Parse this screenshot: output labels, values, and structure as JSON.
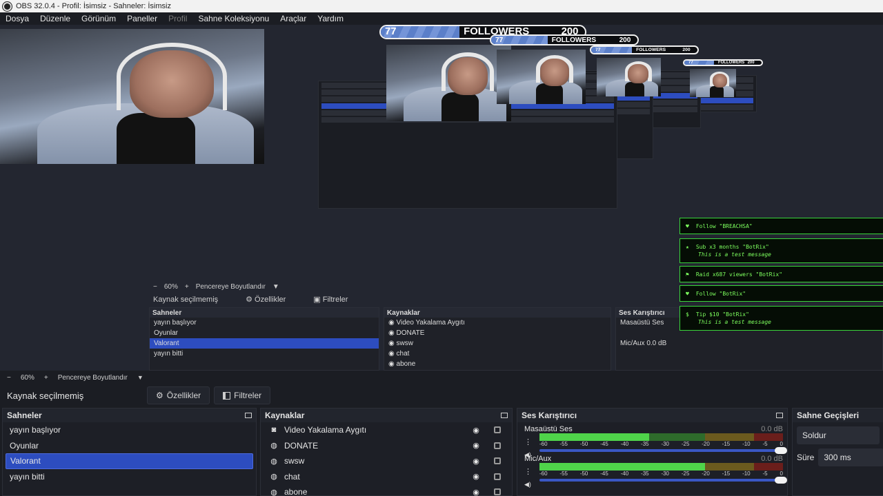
{
  "window": {
    "title": "OBS 32.0.4 - Profil: İsimsiz - Sahneler: İsimsiz"
  },
  "menu": [
    "Dosya",
    "Düzenle",
    "Görünüm",
    "Paneller",
    "Profil",
    "Sahne Koleksiyonu",
    "Araçlar",
    "Yardım"
  ],
  "menu_disabled": "Profil",
  "preview": {
    "follower_count": "77",
    "follower_label": "FOLLOWERS",
    "follower_goal": "200",
    "follower_progress": 0.385,
    "notifications": [
      {
        "icon": "heart",
        "text": "Follow \"BREACHSA\"",
        "sub": ""
      },
      {
        "icon": "star",
        "text": "Sub x3 months \"BotRix\"",
        "sub": "This is a test message"
      },
      {
        "icon": "users",
        "text": "Raid x687 viewers \"BotRix\"",
        "sub": ""
      },
      {
        "icon": "heart",
        "text": "Follow \"BotRix\"",
        "sub": ""
      },
      {
        "icon": "money",
        "text": "Tip $10 \"BotRix\"",
        "sub": "This is a test message"
      }
    ],
    "inner": {
      "zoom": "60%",
      "fit": "Pencereye Boyutlandır",
      "no_source": "Kaynak seçilmemiş",
      "props": "Özellikler",
      "filters": "Filtreler",
      "scenes_title": "Sahneler",
      "sources_title": "Kaynaklar",
      "mixer_title": "Ses Karıştırıcı",
      "desktop": "Masaüstü Ses",
      "mic": "Mic/Aux",
      "mic_db": "0.0 dB",
      "trans_partial": "Süre"
    }
  },
  "toolbar": {
    "minus": "−",
    "zoom": "60%",
    "plus": "+",
    "fit": "Pencereye Boyutlandır"
  },
  "source_bar": {
    "no_source": "Kaynak seçilmemiş",
    "properties": "Özellikler",
    "filters": "Filtreler"
  },
  "scenes": {
    "title": "Sahneler",
    "items": [
      "yayın başlıyor",
      "Oyunlar",
      "Valorant",
      "yayın bitti"
    ],
    "selected_index": 2
  },
  "sources": {
    "title": "Kaynaklar",
    "items": [
      {
        "icon": "camera",
        "name": "Video Yakalama Aygıtı"
      },
      {
        "icon": "globe",
        "name": "DONATE"
      },
      {
        "icon": "globe",
        "name": "swsw"
      },
      {
        "icon": "globe",
        "name": "chat"
      },
      {
        "icon": "globe",
        "name": "abone"
      }
    ]
  },
  "mixer": {
    "title": "Ses Karıştırıcı",
    "scale": [
      "-60",
      "-55",
      "-50",
      "-45",
      "-40",
      "-35",
      "-30",
      "-25",
      "-20",
      "-15",
      "-10",
      "-5",
      "0"
    ],
    "tracks": [
      {
        "name": "Masaüstü Ses",
        "db": "0.0 dB",
        "level": 0.45
      },
      {
        "name": "Mic/Aux",
        "db": "0.0 dB",
        "level": 0.68
      }
    ]
  },
  "transitions": {
    "title": "Sahne Geçişleri",
    "type": "Soldur",
    "duration_label": "Süre",
    "duration": "300 ms"
  },
  "colors": {
    "accent": "#2d4dbf",
    "meter_green": "#4fd44a",
    "meter_yellow": "#d6b92d",
    "meter_red": "#c8312a",
    "notif_green": "#39d63a"
  }
}
